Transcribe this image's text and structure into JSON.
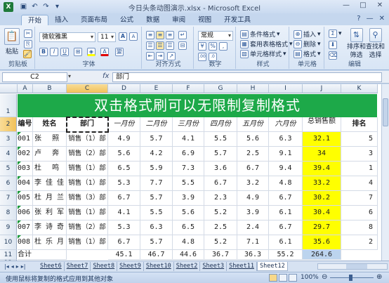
{
  "window": {
    "title": "今日头条动图演示.xlsx - Microsoft Excel",
    "logo": "X",
    "qat": [
      "save-icon",
      "undo-icon",
      "redo-icon",
      "dropdown-icon"
    ],
    "controls": [
      "—",
      "□",
      "✕"
    ]
  },
  "ribbon": {
    "tabs": [
      "开始",
      "插入",
      "页面布局",
      "公式",
      "数据",
      "审阅",
      "视图",
      "开发工具"
    ],
    "active_tab": "开始",
    "right_icons": [
      "?",
      "—",
      "✕"
    ],
    "groups": {
      "clipboard": {
        "label": "剪贴板",
        "paste": "粘贴"
      },
      "font": {
        "label": "字体",
        "font_name": "微软雅黑",
        "font_size": "11",
        "bold": "B",
        "italic": "I",
        "underline": "U",
        "grow": "A",
        "shrink": "A",
        "wen": "變"
      },
      "alignment": {
        "label": "对齐方式"
      },
      "number": {
        "label": "数字",
        "format": "常规",
        "percent": "%",
        "comma": ",",
        "dec_up": ".00",
        "dec_down": ".0"
      },
      "styles": {
        "label": "样式",
        "cond": "条件格式",
        "table": "套用表格格式",
        "cell": "单元格样式"
      },
      "cells": {
        "label": "单元格",
        "insert": "插入",
        "delete": "删除",
        "format": "格式"
      },
      "editing": {
        "label": "编辑",
        "sum": "Σ",
        "sort": "排序和",
        "sort2": "筛选",
        "find": "查找和",
        "find2": "选择"
      }
    }
  },
  "formula_bar": {
    "name_box": "C2",
    "fx": "fx",
    "content": "部门"
  },
  "sheet": {
    "col_headers": [
      "A",
      "B",
      "C",
      "D",
      "E",
      "F",
      "G",
      "H",
      "I",
      "J",
      "K"
    ],
    "row_headers": [
      "1",
      "2",
      "3",
      "4",
      "5",
      "6",
      "7",
      "8",
      "9",
      "10",
      "11",
      "12"
    ],
    "title": "双击格式刷可以无限制复制格式",
    "headers": [
      "编号",
      "姓名",
      "部门",
      "一月份",
      "二月份",
      "三月份",
      "四月份",
      "五月份",
      "六月份",
      "总销售额",
      "排名"
    ],
    "rows": [
      {
        "id": "001",
        "name": "张 照",
        "dept": "销售（1）部",
        "m": [
          "4.9",
          "5.7",
          "4.1",
          "5.5",
          "5.6",
          "6.3"
        ],
        "total": "32.1",
        "rank": "5"
      },
      {
        "id": "002",
        "name": "卢 奔",
        "dept": "销售（2）部",
        "m": [
          "5.6",
          "4.2",
          "6.9",
          "5.7",
          "2.5",
          "9.1"
        ],
        "total": "34",
        "rank": "3"
      },
      {
        "id": "003",
        "name": "杜 鸣",
        "dept": "销售（1）部",
        "m": [
          "6.5",
          "5.9",
          "7.3",
          "3.6",
          "6.7",
          "9.4"
        ],
        "total": "39.4",
        "rank": "1"
      },
      {
        "id": "004",
        "name": "李佳佳",
        "dept": "销售（1）部",
        "m": [
          "5.3",
          "7.7",
          "5.5",
          "6.7",
          "3.2",
          "4.8"
        ],
        "total": "33.2",
        "rank": "4"
      },
      {
        "id": "005",
        "name": "杜月兰",
        "dept": "销售（3）部",
        "m": [
          "6.7",
          "5.7",
          "3.9",
          "2.3",
          "4.9",
          "6.7"
        ],
        "total": "30.2",
        "rank": "7"
      },
      {
        "id": "006",
        "name": "张利军",
        "dept": "销售（1）部",
        "m": [
          "4.1",
          "5.5",
          "5.6",
          "5.2",
          "3.9",
          "6.1"
        ],
        "total": "30.4",
        "rank": "6"
      },
      {
        "id": "007",
        "name": "李诗奇",
        "dept": "销售（2）部",
        "m": [
          "5.3",
          "6.3",
          "6.5",
          "2.5",
          "2.4",
          "6.7"
        ],
        "total": "29.7",
        "rank": "8"
      },
      {
        "id": "008",
        "name": "杜乐月",
        "dept": "销售（1）部",
        "m": [
          "6.7",
          "5.7",
          "4.8",
          "5.2",
          "7.1",
          "6.1"
        ],
        "total": "35.6",
        "rank": "2"
      }
    ],
    "totals": {
      "label": "合计",
      "m": [
        "45.1",
        "46.7",
        "44.6",
        "36.7",
        "36.3",
        "55.2"
      ],
      "total": "264.6"
    },
    "highlight_color": "#ffff00",
    "title_color": "#1da949"
  },
  "sheet_tabs": {
    "nav": [
      "|◂",
      "◂",
      "▸",
      "▸|"
    ],
    "tabs": [
      "Sheet6",
      "Sheet7",
      "Sheet8",
      "Sheet9",
      "Sheet10",
      "Sheet2",
      "Sheet3",
      "Sheet11",
      "Sheet12"
    ],
    "active": "Sheet12"
  },
  "status_bar": {
    "text": "使用鼠标将复制的格式应用到其他对象",
    "zoom": "100%",
    "zoom_minus": "⊖",
    "zoom_plus": "⊕"
  }
}
